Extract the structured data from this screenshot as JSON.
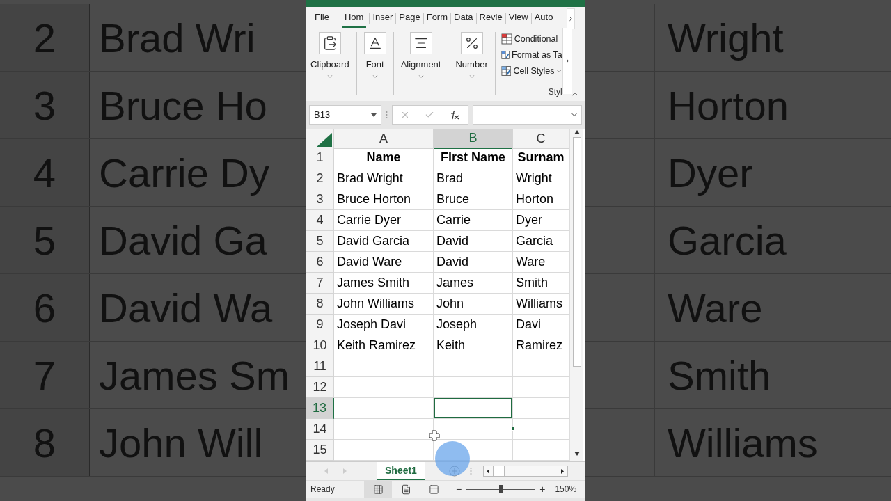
{
  "background_left": {
    "rows": [
      {
        "number": "2",
        "text": "Brad Wri"
      },
      {
        "number": "3",
        "text": "Bruce Ho"
      },
      {
        "number": "4",
        "text": "Carrie Dy"
      },
      {
        "number": "5",
        "text": "David Ga"
      },
      {
        "number": "6",
        "text": "David Wa"
      },
      {
        "number": "7",
        "text": "James Sm"
      },
      {
        "number": "8",
        "text": "John Will"
      }
    ]
  },
  "background_right": {
    "rows": [
      "Wright",
      "Horton",
      "Dyer",
      "Garcia",
      "Ware",
      "Smith",
      "Williams"
    ]
  },
  "ribbon_tabs": [
    {
      "label": "File",
      "selected": false
    },
    {
      "label": "Hom",
      "selected": true
    },
    {
      "label": "Inser",
      "selected": false
    },
    {
      "label": "Page",
      "selected": false
    },
    {
      "label": "Form",
      "selected": false
    },
    {
      "label": "Data",
      "selected": false
    },
    {
      "label": "Revie",
      "selected": false
    },
    {
      "label": "View",
      "selected": false
    },
    {
      "label": "Auto",
      "selected": false
    }
  ],
  "ribbon_groups": [
    {
      "kind": "clipboard",
      "label": "Clipboard"
    },
    {
      "kind": "font",
      "label": "Font"
    },
    {
      "kind": "alignment",
      "label": "Alignment"
    },
    {
      "kind": "number",
      "label": "Number"
    }
  ],
  "styles_group": {
    "label": "Styl",
    "items": [
      {
        "kind": "conditional",
        "label": "Conditional"
      },
      {
        "kind": "table",
        "label": "Format as Ta"
      },
      {
        "kind": "cell_styles",
        "label": "Cell Styles"
      }
    ]
  },
  "name_box": "B13",
  "columns": [
    {
      "label": "A",
      "selected": false
    },
    {
      "label": "B",
      "selected": true
    },
    {
      "label": "C",
      "selected": false
    }
  ],
  "rows": [
    {
      "number": "1",
      "selected": false,
      "header": true,
      "cells": [
        "Name",
        "First Name",
        "Surnam"
      ]
    },
    {
      "number": "2",
      "selected": false,
      "header": false,
      "cells": [
        "Brad Wright",
        "Brad",
        "Wright"
      ]
    },
    {
      "number": "3",
      "selected": false,
      "header": false,
      "cells": [
        "Bruce Horton",
        "Bruce",
        "Horton"
      ]
    },
    {
      "number": "4",
      "selected": false,
      "header": false,
      "cells": [
        "Carrie Dyer",
        "Carrie",
        "Dyer"
      ]
    },
    {
      "number": "5",
      "selected": false,
      "header": false,
      "cells": [
        "David Garcia",
        "David",
        "Garcia"
      ]
    },
    {
      "number": "6",
      "selected": false,
      "header": false,
      "cells": [
        "David Ware",
        "David",
        "Ware"
      ]
    },
    {
      "number": "7",
      "selected": false,
      "header": false,
      "cells": [
        "James Smith",
        "James",
        "Smith"
      ]
    },
    {
      "number": "8",
      "selected": false,
      "header": false,
      "cells": [
        "John Williams",
        "John",
        "Williams"
      ]
    },
    {
      "number": "9",
      "selected": false,
      "header": false,
      "cells": [
        "Joseph Davi",
        "Joseph",
        "Davi"
      ]
    },
    {
      "number": "10",
      "selected": false,
      "header": false,
      "cells": [
        "Keith Ramirez",
        "Keith",
        "Ramirez"
      ]
    },
    {
      "number": "11",
      "selected": false
    },
    {
      "number": "12",
      "selected": false
    },
    {
      "number": "13",
      "selected": true
    },
    {
      "number": "14",
      "selected": false
    },
    {
      "number": "15",
      "selected": false
    }
  ],
  "sheet_tabs": [
    {
      "label": "Sheet1",
      "selected": true
    }
  ],
  "status_bar": {
    "text": "Ready",
    "views": [
      {
        "kind": "normal",
        "selected": true
      },
      {
        "kind": "page_layout",
        "selected": false
      },
      {
        "kind": "page_break",
        "selected": false
      }
    ],
    "zoom": {
      "zoom_out": "−",
      "level": 0.5,
      "zoom_in": "+",
      "reading": "150%"
    }
  }
}
